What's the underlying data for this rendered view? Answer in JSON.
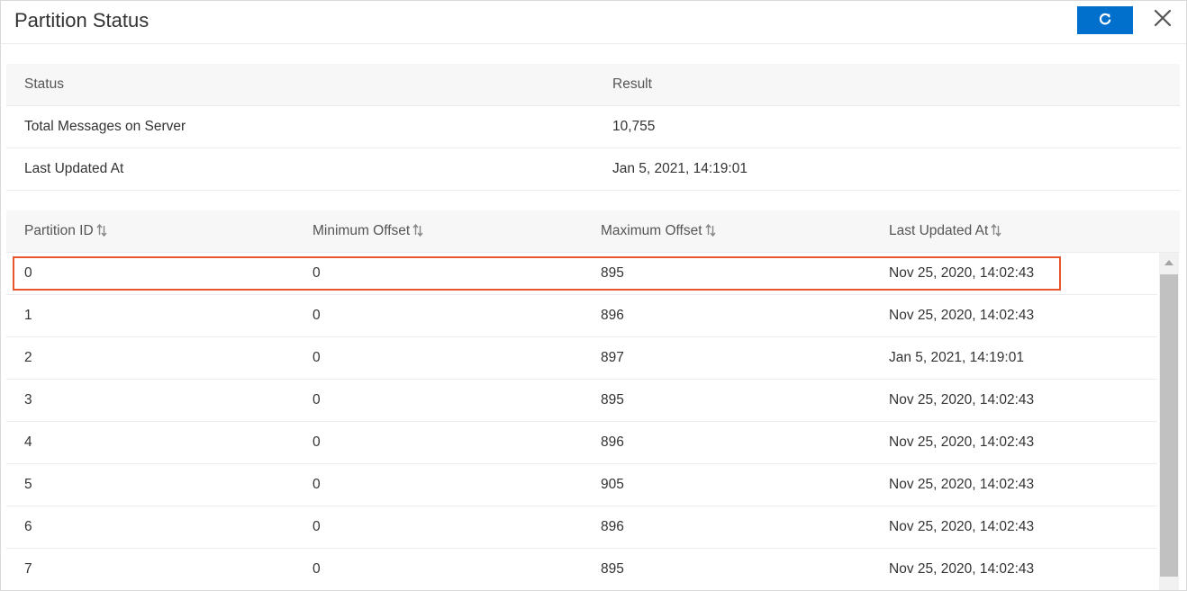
{
  "dialog": {
    "title": "Partition Status",
    "refresh_icon": "refresh-icon",
    "close_icon": "close-icon",
    "accent_color": "#0070cc",
    "highlight_color": "#e8552d"
  },
  "summary": {
    "headers": [
      "Status",
      "Result"
    ],
    "rows": [
      [
        "Total Messages on Server",
        "10,755"
      ],
      [
        "Last Updated At",
        "Jan 5, 2021, 14:19:01"
      ]
    ]
  },
  "partitions": {
    "headers": [
      "Partition ID",
      "Minimum Offset",
      "Maximum Offset",
      "Last Updated At"
    ],
    "sort_icon": "sort-icon",
    "highlighted_row": 0,
    "rows": [
      [
        "0",
        "0",
        "895",
        "Nov 25, 2020, 14:02:43"
      ],
      [
        "1",
        "0",
        "896",
        "Nov 25, 2020, 14:02:43"
      ],
      [
        "2",
        "0",
        "897",
        "Jan 5, 2021, 14:19:01"
      ],
      [
        "3",
        "0",
        "895",
        "Nov 25, 2020, 14:02:43"
      ],
      [
        "4",
        "0",
        "896",
        "Nov 25, 2020, 14:02:43"
      ],
      [
        "5",
        "0",
        "905",
        "Nov 25, 2020, 14:02:43"
      ],
      [
        "6",
        "0",
        "896",
        "Nov 25, 2020, 14:02:43"
      ],
      [
        "7",
        "0",
        "895",
        "Nov 25, 2020, 14:02:43"
      ]
    ]
  }
}
